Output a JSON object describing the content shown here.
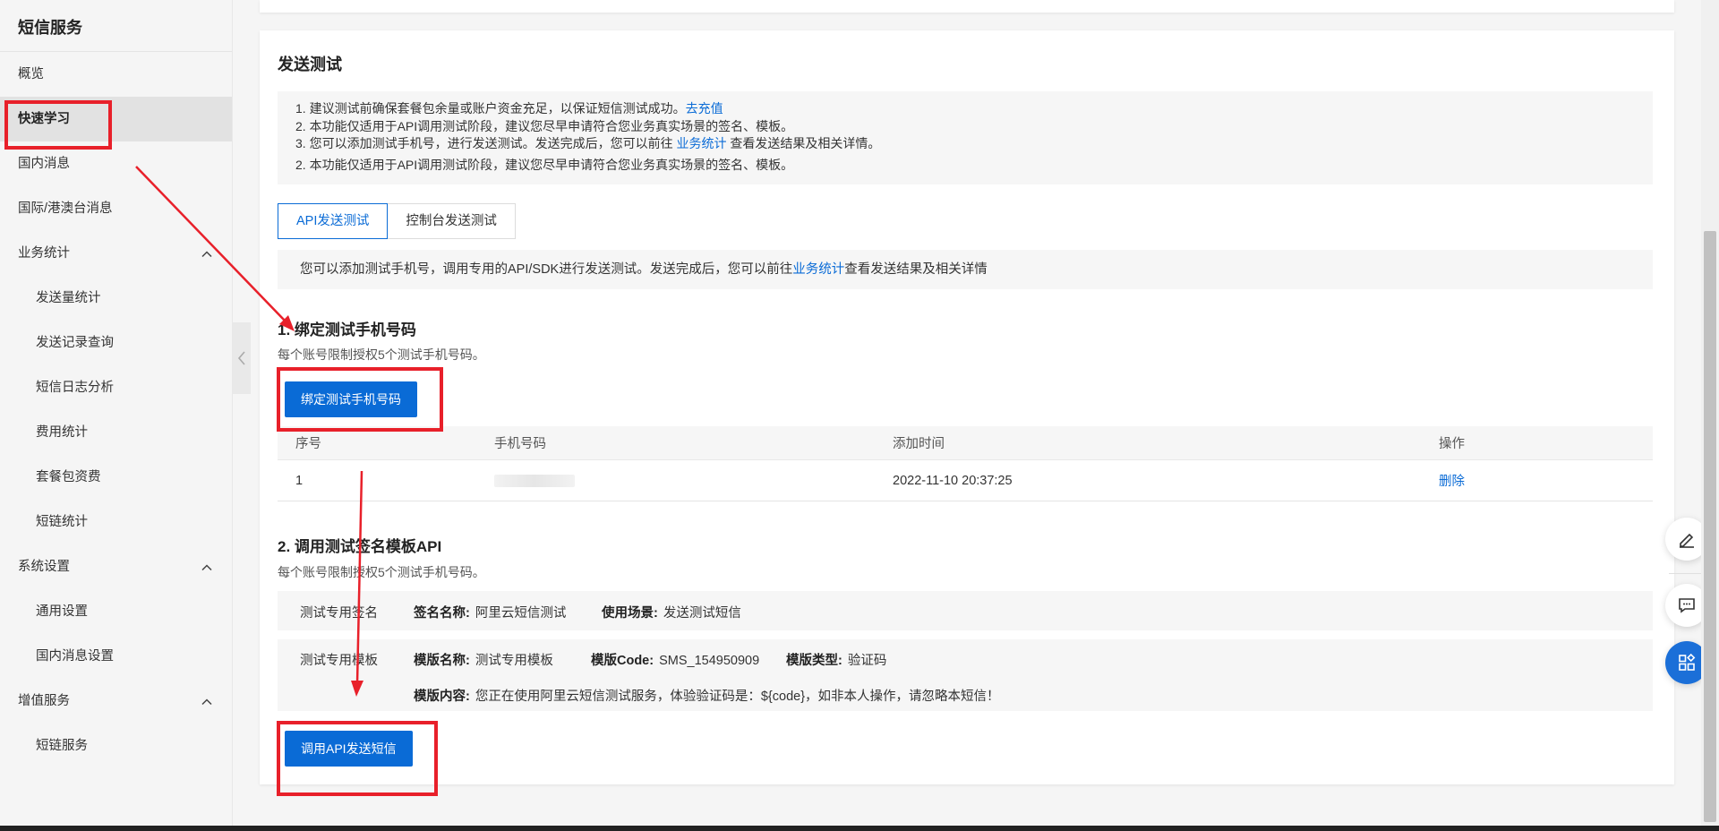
{
  "sidebar": {
    "title": "短信服务",
    "items": [
      {
        "label": "概览"
      },
      {
        "label": "快速学习"
      },
      {
        "label": "国内消息"
      },
      {
        "label": "国际/港澳台消息"
      },
      {
        "label": "业务统计"
      },
      {
        "label": "发送量统计"
      },
      {
        "label": "发送记录查询"
      },
      {
        "label": "短信日志分析"
      },
      {
        "label": "费用统计"
      },
      {
        "label": "套餐包资费"
      },
      {
        "label": "短链统计"
      },
      {
        "label": "系统设置"
      },
      {
        "label": "通用设置"
      },
      {
        "label": "国内消息设置"
      },
      {
        "label": "增值服务"
      },
      {
        "label": "短链服务"
      }
    ]
  },
  "main": {
    "title": "发送测试",
    "notice": {
      "line1": "1. 建议测试前确保套餐包余量或账户资金充足，以保证短信测试成功。",
      "line1_link": "去充值",
      "line2": "2. 本功能仅适用于API调用测试阶段，建议您尽早申请符合您业务真实场景的签名、模板。",
      "line3_a": "3. 您可以添加测试手机号，进行发送测试。发送完成后，您可以前往",
      "line3_link": "业务统计",
      "line3_b": "查看发送结果及相关详情。",
      "line4": "2. 本功能仅适用于API调用测试阶段，建议您尽早申请符合您业务真实场景的签名、模板。"
    },
    "tabs": [
      {
        "label": "API发送测试"
      },
      {
        "label": "控制台发送测试"
      }
    ],
    "info_bar": {
      "text_a": "您可以添加测试手机号，调用专用的API/SDK进行发送测试。发送完成后，您可以前往",
      "link": "业务统计",
      "text_b": "查看发送结果及相关详情"
    },
    "section1": {
      "title": "1. 绑定测试手机号码",
      "subtitle": "每个账号限制授权5个测试手机号码。",
      "button": "绑定测试手机号码",
      "table": {
        "headers": [
          "序号",
          "手机号码",
          "添加时间",
          "操作"
        ],
        "rows": [
          {
            "index": "1",
            "phone": "",
            "time": "2022-11-10 20:37:25",
            "action": "删除"
          }
        ]
      }
    },
    "section2": {
      "title": "2. 调用测试签名模板API",
      "subtitle": "每个账号限制授权5个测试手机号码。",
      "sign": {
        "label": "测试专用签名",
        "name_key": "签名名称:",
        "name_val": "阿里云短信测试",
        "scene_key": "使用场景:",
        "scene_val": "发送测试短信"
      },
      "template": {
        "label": "测试专用模板",
        "name_key": "模版名称:",
        "name_val": "测试专用模板",
        "code_key": "模版Code:",
        "code_val": "SMS_154950909",
        "type_key": "模版类型:",
        "type_val": "验证码",
        "content_key": "模版内容:",
        "content_val": "您正在使用阿里云短信测试服务，体验验证码是：${code}，如非本人操作，请忽略本短信！"
      },
      "button": "调用API发送短信"
    }
  },
  "colors": {
    "primary": "#0a6bd6",
    "annotation": "#e8202a"
  },
  "icons": {
    "collapse": "chevron-left-icon",
    "expand": "chevron-up-icon",
    "edit": "edit-icon",
    "feedback": "chat-icon",
    "apps": "apps-icon"
  }
}
